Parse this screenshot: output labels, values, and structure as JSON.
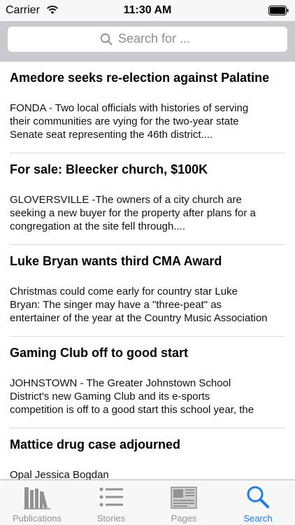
{
  "status_bar": {
    "carrier": "Carrier",
    "time": "11:30 AM"
  },
  "search": {
    "placeholder": "Search for ...",
    "icon": "search-icon"
  },
  "articles": [
    {
      "title": "Amedore seeks re-election against Palatine",
      "summary_lines": [
        "FONDA - Two local officials with histories of serving",
        "their communities are vying for the two-year state",
        "Senate seat representing the 46th district...."
      ]
    },
    {
      "title": "For sale: Bleecker church, $100K",
      "summary_lines": [
        "GLOVERSVILLE -The owners of a city church are",
        "seeking a new buyer for the property after plans for a",
        "congregation at the site fell through...."
      ]
    },
    {
      "title": "Luke Bryan wants third CMA Award",
      "summary_lines": [
        "Christmas could come early for country star Luke",
        "Bryan: The singer may have a \"three-peat\" as",
        "entertainer of the year at the Country Music Association"
      ]
    },
    {
      "title": "Gaming Club off to good start",
      "summary_lines": [
        "JOHNSTOWN - The Greater Johnstown School",
        "District's new Gaming Club and its e-sports",
        "competition is off to a good start this school year, the"
      ]
    },
    {
      "title": "Mattice drug case adjourned",
      "summary_lines": [
        "Opal Jessica Bogdan"
      ]
    }
  ],
  "tab_bar": {
    "tabs": [
      {
        "label": "Publications",
        "icon": "books-icon",
        "active": false
      },
      {
        "label": "Stories",
        "icon": "list-icon",
        "active": false
      },
      {
        "label": "Pages",
        "icon": "newspaper-icon",
        "active": false
      },
      {
        "label": "Search",
        "icon": "search-icon",
        "active": true
      }
    ],
    "active_color": "#1b7cf6",
    "inactive_color": "#929292"
  }
}
